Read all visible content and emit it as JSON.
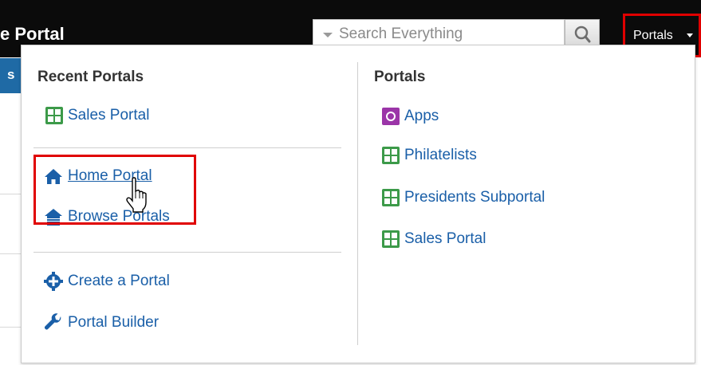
{
  "header": {
    "page_title": "e Portal",
    "search_placeholder": "Search Everything",
    "portals_menu_label": "Portals"
  },
  "page_stub": {
    "nav_text": "s"
  },
  "dropdown": {
    "recent": {
      "heading": "Recent Portals",
      "items": [
        {
          "label": "Sales Portal",
          "icon": "portal-grid-icon"
        }
      ]
    },
    "links": [
      {
        "label": "Home Portal",
        "icon": "home-icon"
      },
      {
        "label": "Browse Portals",
        "icon": "browse-portals-icon"
      }
    ],
    "actions": [
      {
        "label": "Create a Portal",
        "icon": "plus-gear-icon"
      },
      {
        "label": "Portal Builder",
        "icon": "wrench-icon"
      }
    ],
    "portals": {
      "heading": "Portals",
      "items": [
        {
          "label": "Apps",
          "icon": "apps-icon"
        },
        {
          "label": "Philatelists",
          "icon": "portal-grid-icon"
        },
        {
          "label": "Presidents Subportal",
          "icon": "portal-grid-icon"
        },
        {
          "label": "Sales Portal",
          "icon": "portal-grid-icon"
        }
      ]
    }
  },
  "colors": {
    "header_bg": "#0b0b0b",
    "link": "#1a5fa8",
    "highlight": "#e00000",
    "portal_icon": "#3c9a49",
    "apps_icon": "#9b35a8"
  }
}
